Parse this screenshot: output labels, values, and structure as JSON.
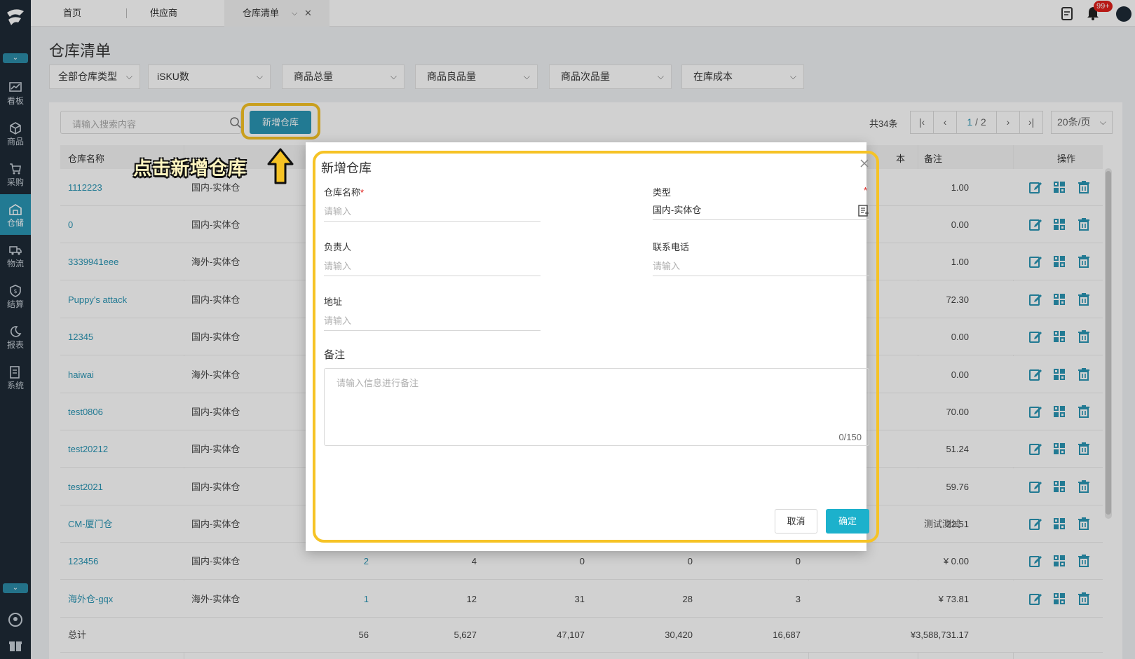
{
  "tabs": [
    {
      "label": "首页"
    },
    {
      "label": "供应商"
    },
    {
      "label": "仓库清单"
    }
  ],
  "badge": "99+",
  "sidebar": {
    "items": [
      {
        "label": "看板",
        "icon": "chart-icon"
      },
      {
        "label": "商品",
        "icon": "box-icon"
      },
      {
        "label": "采购",
        "icon": "cart-icon"
      },
      {
        "label": "仓储",
        "icon": "warehouse-icon"
      },
      {
        "label": "物流",
        "icon": "truck-icon"
      },
      {
        "label": "结算",
        "icon": "shield-dollar-icon"
      },
      {
        "label": "报表",
        "icon": "moon-icon"
      },
      {
        "label": "系统",
        "icon": "document-icon"
      }
    ]
  },
  "page_title": "仓库清单",
  "filters": [
    "全部仓库类型",
    "iSKU数",
    "商品总量",
    "商品良品量",
    "商品次品量",
    "在库成本"
  ],
  "search_placeholder": "请输入搜索内容",
  "add_button": "新增仓库",
  "total": "共34条",
  "pager": {
    "current": "1",
    "total_pages": "/ 2",
    "page_size": "20条/页"
  },
  "table": {
    "headers": {
      "name": "仓库名称",
      "cost_partial": "本",
      "note": "备注",
      "ops": "操作"
    },
    "rows": [
      {
        "name": "1112223",
        "type": "国内-实体仓",
        "cost": "1.00",
        "note": ""
      },
      {
        "name": "0",
        "type": "国内-实体仓",
        "cost": "0.00",
        "note": ""
      },
      {
        "name": "3339941eee",
        "type": "海外-实体仓",
        "cost": "1.00",
        "note": ""
      },
      {
        "name": "Puppy's attack",
        "type": "国内-实体仓",
        "cost": "72.30",
        "note": ""
      },
      {
        "name": "12345",
        "type": "国内-实体仓",
        "cost": "0.00",
        "note": ""
      },
      {
        "name": "haiwai",
        "type": "海外-实体仓",
        "cost": "0.00",
        "note": ""
      },
      {
        "name": "test0806",
        "type": "国内-实体仓",
        "cost": "70.00",
        "note": ""
      },
      {
        "name": "test20212",
        "type": "国内-实体仓",
        "cost": "51.24",
        "note": ""
      },
      {
        "name": "test2021",
        "type": "国内-实体仓",
        "cost": "59.76",
        "note": ""
      },
      {
        "name": "CM-厦门仓",
        "type": "国内-实体仓",
        "cost": "22.51",
        "note": "测试测试"
      },
      {
        "name": "123456",
        "type": "国内-实体仓",
        "isku": "2",
        "qty": "4",
        "good": "0",
        "bad": "0",
        "x": "0",
        "cost": "¥ 0.00",
        "note": ""
      },
      {
        "name": "海外仓-gqx",
        "type": "海外-实体仓",
        "isku": "1",
        "qty": "12",
        "good": "31",
        "bad": "28",
        "x": "3",
        "cost": "¥ 73.81",
        "note": ""
      }
    ],
    "summary": {
      "label": "总计",
      "isku": "56",
      "qty": "5,627",
      "good": "47,107",
      "bad": "30,420",
      "x": "16,687",
      "cost": "¥3,588,731.17"
    }
  },
  "annotation": "点击新增仓库",
  "modal": {
    "title": "新增仓库",
    "name_label": "仓库名称",
    "name_placeholder": "请输入",
    "type_label": "类型",
    "type_value": "国内-实体仓",
    "owner_label": "负责人",
    "owner_placeholder": "请输入",
    "phone_label": "联系电话",
    "phone_placeholder": "请输入",
    "address_label": "地址",
    "address_placeholder": "请输入",
    "note_label": "备注",
    "note_placeholder": "请输入信息进行备注",
    "note_count": "0/150",
    "cancel": "取消",
    "ok": "确定",
    "required_mark": "*"
  }
}
